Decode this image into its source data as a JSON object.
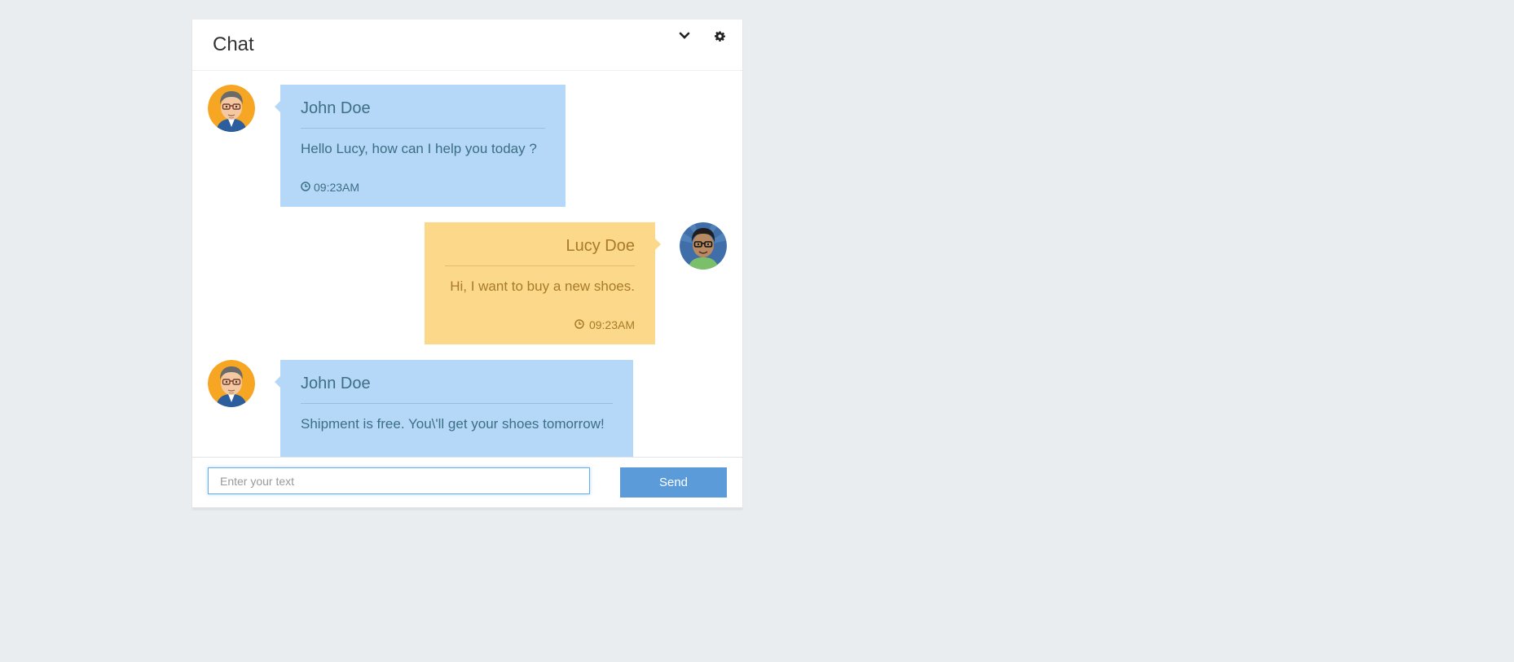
{
  "chat": {
    "title": "Chat",
    "header_icons": [
      "chevron-down-icon",
      "gear-icon"
    ],
    "messages": [
      {
        "sender": "John Doe",
        "text": "Hello Lucy, how can I help you today ?",
        "time": "09:23AM",
        "direction": "incoming",
        "bubble_color": "#b5d8f9"
      },
      {
        "sender": "Lucy Doe",
        "text": "Hi, I want to buy a new shoes.",
        "time": "09:23AM",
        "direction": "outgoing",
        "bubble_color": "#fcd98a"
      },
      {
        "sender": "John Doe",
        "text": "Shipment is free. You\\'ll get your shoes tomorrow!",
        "time": "",
        "direction": "incoming",
        "bubble_color": "#b5d8f9"
      }
    ]
  },
  "composer": {
    "placeholder": "Enter your text",
    "value": "",
    "send_label": "Send"
  },
  "colors": {
    "background": "#e9edf0",
    "send_button": "#5b9bd9",
    "incoming_text": "#3c6f84",
    "outgoing_text": "#a87a2a"
  }
}
